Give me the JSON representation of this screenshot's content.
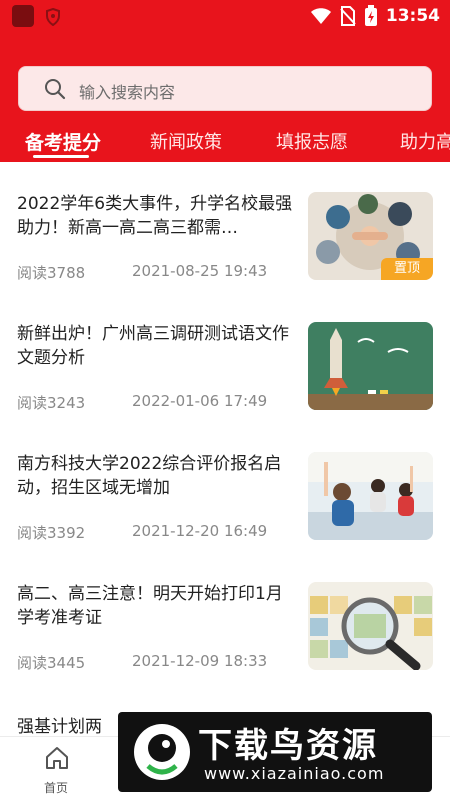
{
  "status_bar": {
    "time": "13:54"
  },
  "search": {
    "placeholder": "输入搜索内容"
  },
  "tabs": [
    {
      "label": "备考提分",
      "active": true
    },
    {
      "label": "新闻政策",
      "active": false
    },
    {
      "label": "填报志愿",
      "active": false
    },
    {
      "label": "助力高",
      "active": false
    }
  ],
  "articles": [
    {
      "title": "2022学年6类大事件，升学名校最强助力！新高一高二高三都需…",
      "reads": "阅读3788",
      "date": "2021-08-25 19:43",
      "badge": "置顶",
      "thumb": "hands-teamwork-icon"
    },
    {
      "title": "新鲜出炉！广州高三调研测试语文作文题分析",
      "reads": "阅读3243",
      "date": "2022-01-06 17:49",
      "thumb": "rocket-chalkboard-icon"
    },
    {
      "title": "南方科技大学2022综合评价报名启动，招生区域无增加",
      "reads": "阅读3392",
      "date": "2021-12-20 16:49",
      "thumb": "classroom-students-icon"
    },
    {
      "title": "高二、高三注意！明天开始打印1月学考准考证",
      "reads": "阅读3445",
      "date": "2021-12-09 18:33",
      "thumb": "periodic-magnifier-icon"
    }
  ],
  "partial_article": {
    "title": "强基计划两"
  },
  "bottom_nav": {
    "home_label": "首页"
  },
  "watermark": {
    "title": "下载鸟资源",
    "url": "www.xiazainiao.com"
  },
  "colors": {
    "primary": "#e8141c",
    "badge": "#f6a624"
  }
}
